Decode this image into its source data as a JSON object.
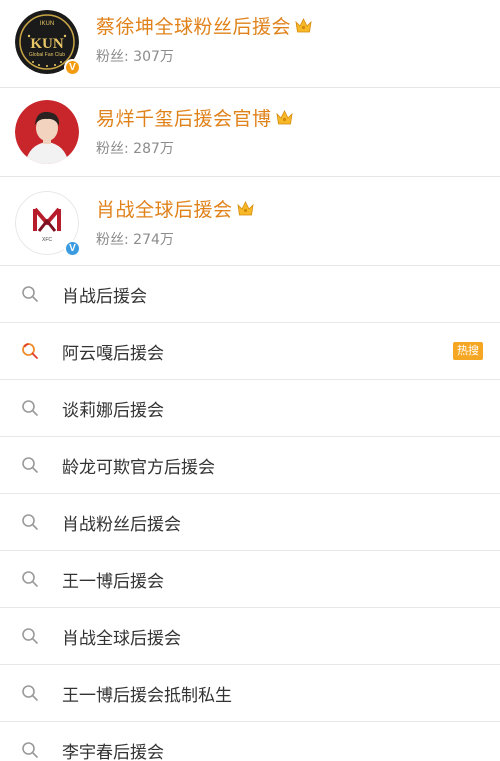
{
  "accounts": [
    {
      "name": "蔡徐坤全球粉丝后援会",
      "fans": "粉丝: 307万",
      "avatar_text_top": "IKUN",
      "avatar_text_main": "KUN",
      "avatar_text_sub": "Global Fan Club",
      "badge": "V",
      "badge_color": "#f39c12"
    },
    {
      "name": "易烊千玺后援会官博",
      "fans": "粉丝: 287万"
    },
    {
      "name": "肖战全球后援会",
      "fans": "粉丝: 274万",
      "avatar_text": "XFC",
      "badge": "V",
      "badge_color": "#3b9be0"
    }
  ],
  "suggestions": [
    {
      "text": "肖战后援会",
      "icon": "search-icon"
    },
    {
      "text": "阿云嘎后援会",
      "icon": "hot-search-icon",
      "tag": "热搜"
    },
    {
      "text": "谈莉娜后援会",
      "icon": "search-icon"
    },
    {
      "text": "龄龙可欺官方后援会",
      "icon": "search-icon"
    },
    {
      "text": "肖战粉丝后援会",
      "icon": "search-icon"
    },
    {
      "text": "王一博后援会",
      "icon": "search-icon"
    },
    {
      "text": "肖战全球后援会",
      "icon": "search-icon"
    },
    {
      "text": "王一博后援会抵制私生",
      "icon": "search-icon"
    },
    {
      "text": "李宇春后援会",
      "icon": "search-icon"
    }
  ],
  "colors": {
    "account_name": "#e0821a",
    "hot_tag": "#f5a623",
    "divider": "#e6e6e6"
  }
}
